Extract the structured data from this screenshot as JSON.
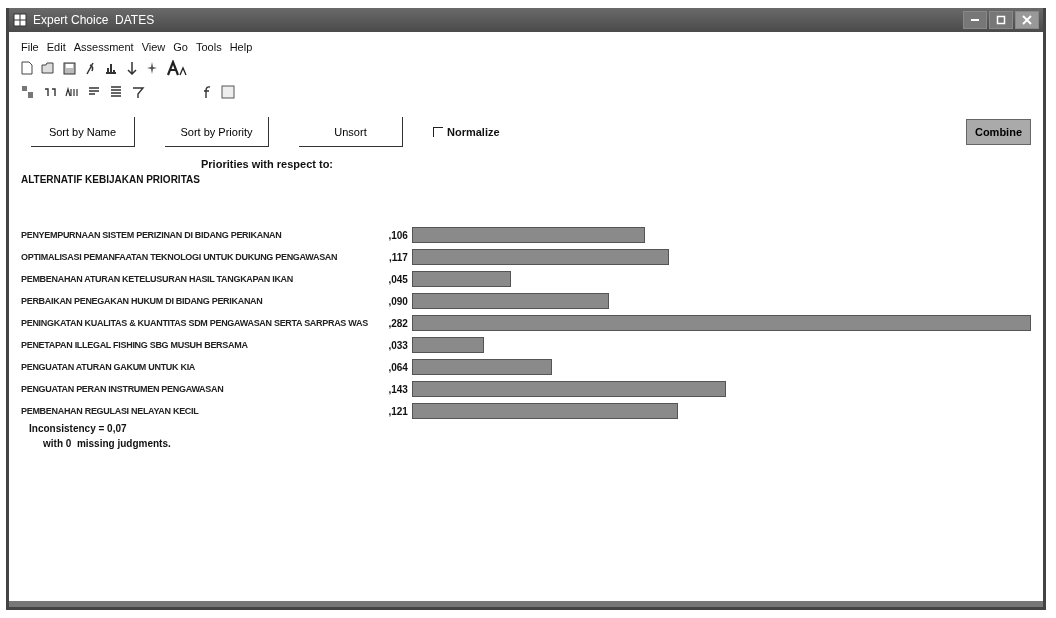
{
  "window": {
    "title": "Expert Choice  DATES"
  },
  "menu": [
    {
      "label": "File"
    },
    {
      "label": "Edit"
    },
    {
      "label": "Assessment"
    },
    {
      "label": "View"
    },
    {
      "label": "Go"
    },
    {
      "label": "Tools"
    },
    {
      "label": "Help"
    }
  ],
  "buttons": [
    {
      "label": "Sort by Name"
    },
    {
      "label": "Sort by Priority"
    },
    {
      "label": "Unsort"
    }
  ],
  "normalize": {
    "label": "Normalize",
    "checked": false
  },
  "combine_button": "Combine",
  "heading": "Priorities with respect to:",
  "goal": "ALTERNATIF KEBIJAKAN PRIORITAS",
  "rows": [
    {
      "name": "PENYEMPURNAAN SISTEM PERIZINAN DI BIDANG PERIKANAN",
      "value": ",106"
    },
    {
      "name": "OPTIMALISASI PEMANFAATAN TEKNOLOGI UNTUK DUKUNG PENGAWASAN",
      "value": ",117"
    },
    {
      "name": "PEMBENAHAN ATURAN KETELUSURAN HASIL TANGKAPAN IKAN",
      "value": ",045"
    },
    {
      "name": "PERBAIKAN PENEGAKAN HUKUM DI BIDANG PERIKANAN",
      "value": ",090"
    },
    {
      "name": "PENINGKATAN KUALITAS & KUANTITAS SDM PENGAWASAN SERTA  SARPRAS WAS",
      "value": ",282"
    },
    {
      "name": "PENETAPAN ILLEGAL FISHING SBG MUSUH BERSAMA",
      "value": ",033"
    },
    {
      "name": "PENGUATAN ATURAN GAKUM UNTUK KIA",
      "value": ",064"
    },
    {
      "name": "PENGUATAN PERAN INSTRUMEN PENGAWASAN",
      "value": ",143"
    },
    {
      "name": "PEMBENAHAN REGULASI NELAYAN KECIL",
      "value": ",121"
    }
  ],
  "inconsistency": "Inconsistency = 0,07",
  "missing": "with 0  missing judgments."
}
